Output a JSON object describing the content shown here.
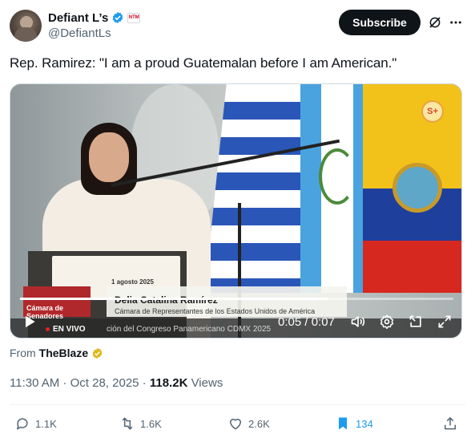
{
  "author": {
    "display_name": "Defiant L’s",
    "handle": "@DefiantLs",
    "affiliation_badge_text": "NTM"
  },
  "header": {
    "subscribe_label": "Subscribe"
  },
  "tweet": {
    "text": "Rep. Ramirez: \"I am a proud Guatemalan before I am American.\""
  },
  "video": {
    "overlay_badge": "S+",
    "lectern_sign_date": "1 agosto 2025",
    "lower_third": {
      "channel": "Cámara de Senadores",
      "name": "Delia Catalina Ramírez",
      "title": "Cámara de Representantes de los Estados Unidos de América",
      "live": "EN VIVO",
      "ticker": "ción del Congreso Panamericano CDMX 2025"
    },
    "progress": 0.71,
    "time_display": "0:05 / 0:07"
  },
  "source": {
    "prefix": "From",
    "name": "TheBlaze"
  },
  "meta": {
    "time": "11:30 AM",
    "separator1": " · ",
    "date": "Oct 28, 2025",
    "separator2": " · ",
    "views_count": "118.2K",
    "views_label": " Views"
  },
  "actions": {
    "replies": "1.1K",
    "retweets": "1.6K",
    "likes": "2.6K",
    "bookmarks": "134"
  },
  "colors": {
    "verified_blue": "#1d9bf0",
    "gold_badge": "#e2b719",
    "text_primary": "#0f1419",
    "text_secondary": "#536471"
  },
  "icons": [
    "verified-icon",
    "grok-icon",
    "more-icon",
    "play-icon",
    "volume-icon",
    "settings-icon",
    "pip-icon",
    "fullscreen-icon",
    "reply-icon",
    "retweet-icon",
    "like-icon",
    "bookmark-icon",
    "share-icon"
  ]
}
